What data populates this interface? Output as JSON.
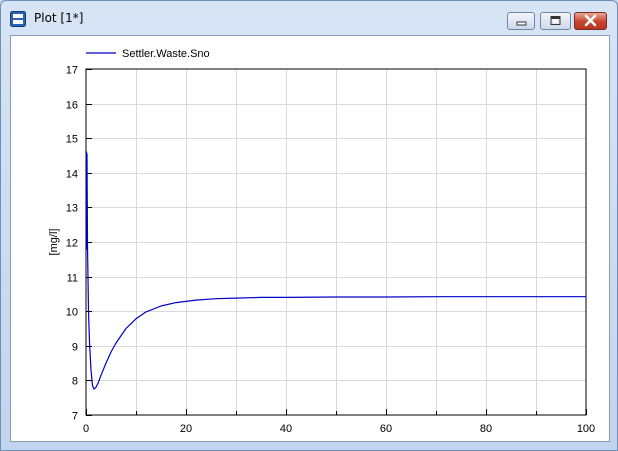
{
  "window": {
    "title": "Plot [1*]",
    "icons": {
      "app": "plot-window-icon",
      "minimize": "minimize-icon",
      "maximize": "maximize-icon",
      "close": "close-icon"
    }
  },
  "colors": {
    "series": "#0000c8",
    "grid": "#d9d9d9",
    "frame": "#000000"
  },
  "chart_data": {
    "type": "line",
    "title": "",
    "xlabel": "",
    "ylabel": "[mg/l]",
    "xlim": [
      0,
      100
    ],
    "ylim": [
      7,
      17
    ],
    "x_ticks": [
      0,
      20,
      40,
      60,
      80,
      100
    ],
    "y_ticks": [
      7,
      8,
      9,
      10,
      11,
      12,
      13,
      14,
      15,
      16,
      17
    ],
    "grid": true,
    "legend_position": "top-left",
    "series": [
      {
        "name": "Settler.Waste.Sno",
        "x": [
          0,
          0.1,
          0.15,
          0.2,
          0.3,
          0.5,
          0.7,
          1.0,
          1.3,
          1.6,
          2.0,
          2.5,
          3.0,
          4.0,
          5.0,
          6.0,
          8.0,
          10.0,
          12.0,
          15.0,
          18.0,
          22.0,
          26.0,
          30.0,
          35.0,
          40.0,
          50.0,
          60.0,
          70.0,
          80.0,
          90.0,
          100.0
        ],
        "y": [
          14.6,
          14.6,
          11.8,
          14.55,
          11.9,
          10.0,
          9.1,
          8.3,
          7.85,
          7.75,
          7.8,
          7.95,
          8.15,
          8.5,
          8.82,
          9.08,
          9.5,
          9.78,
          9.98,
          10.15,
          10.25,
          10.32,
          10.36,
          10.38,
          10.4,
          10.4,
          10.41,
          10.41,
          10.42,
          10.42,
          10.42,
          10.42
        ]
      }
    ]
  }
}
